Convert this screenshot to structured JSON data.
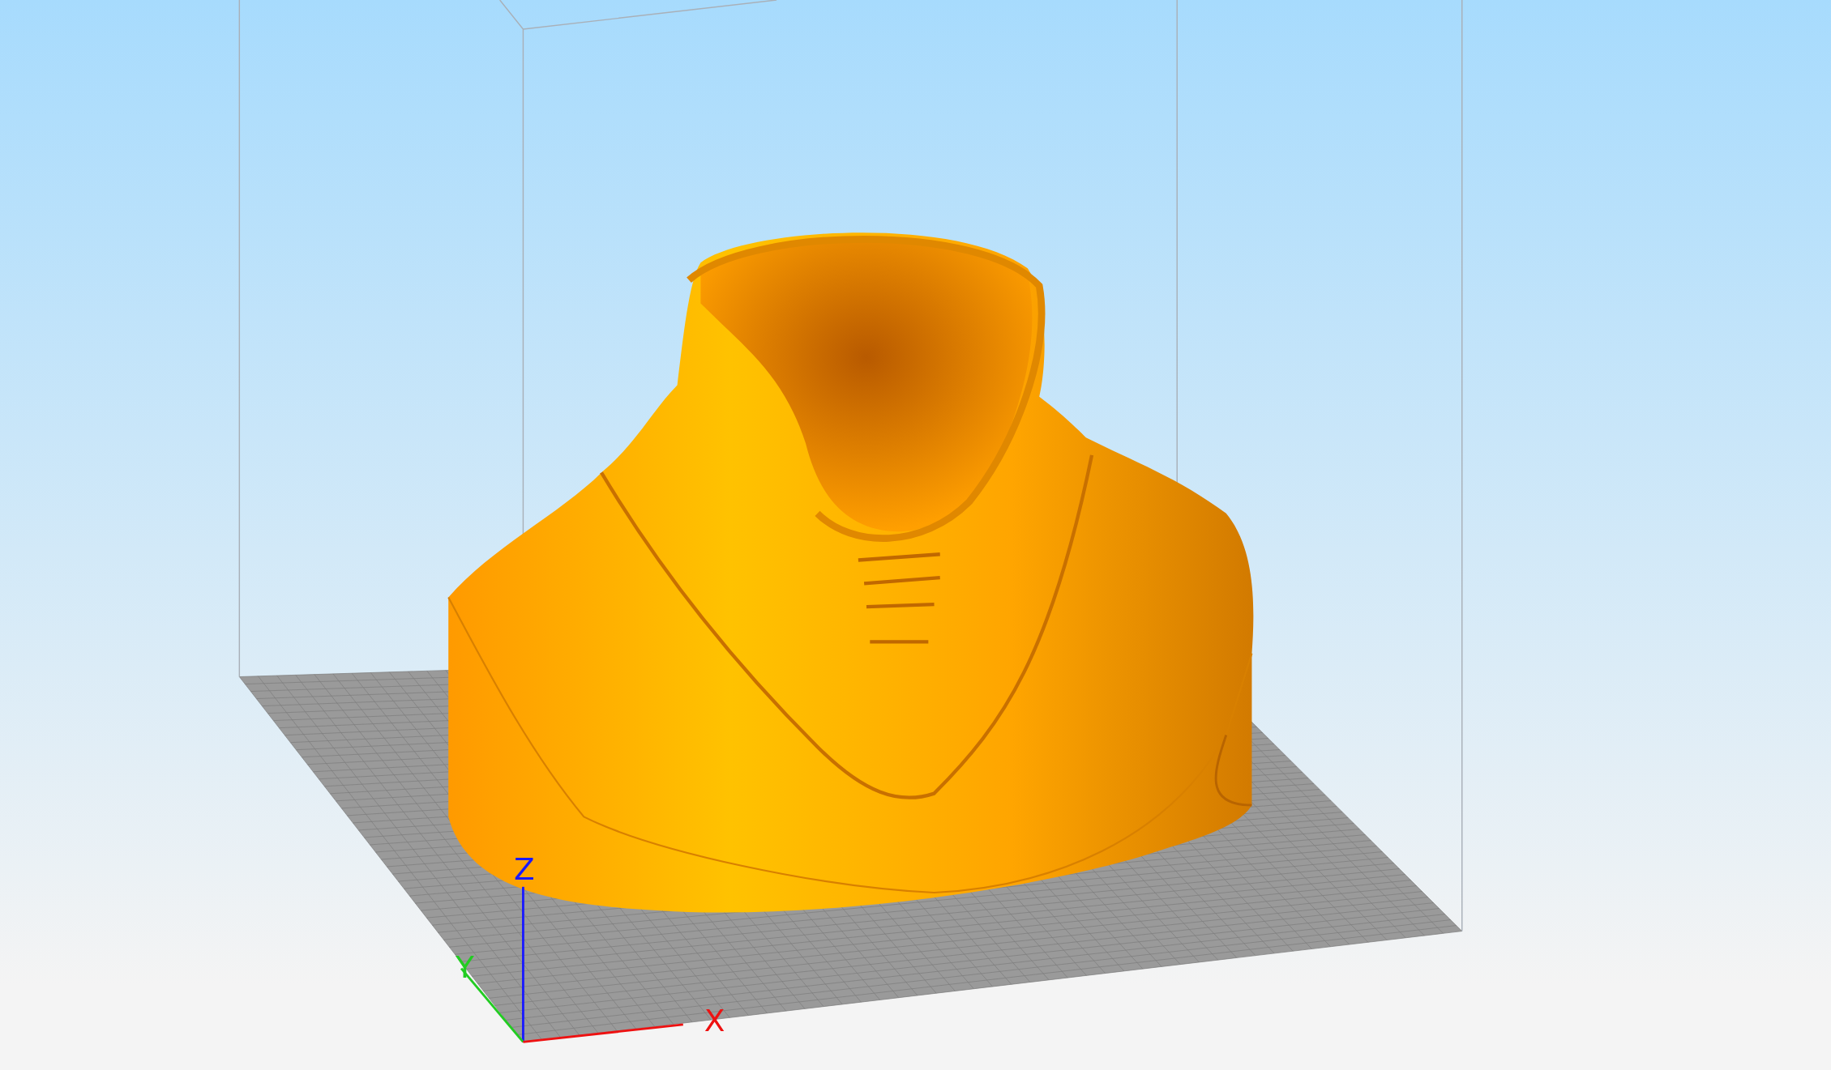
{
  "viewport": {
    "axes": [
      {
        "kind": "z",
        "label": "Z",
        "color": "#1a1aff"
      },
      {
        "kind": "y",
        "label": "Y",
        "color": "#22cc22"
      },
      {
        "kind": "x",
        "label": "X",
        "color": "#ee1111"
      }
    ]
  }
}
